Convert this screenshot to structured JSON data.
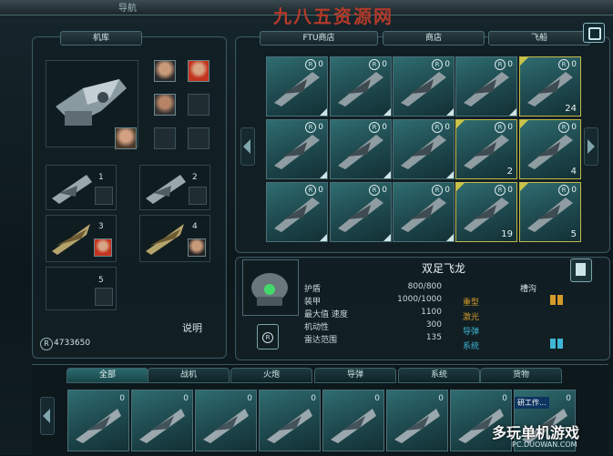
{
  "topbar": {
    "left_button": "导航",
    "watermark": "九八五资源网"
  },
  "left_panel": {
    "tab": "机库",
    "slots": [
      {
        "num": "1"
      },
      {
        "num": "2"
      },
      {
        "num": "3"
      },
      {
        "num": "4"
      },
      {
        "num": "5"
      }
    ],
    "help_label": "说明",
    "credits": "4733650"
  },
  "shop": {
    "tabs": [
      "FTU商店",
      "商店",
      "飞船"
    ],
    "grid": [
      {
        "qty": "0",
        "gold": false
      },
      {
        "qty": "0",
        "gold": false
      },
      {
        "qty": "0",
        "gold": false
      },
      {
        "qty": "0",
        "gold": false
      },
      {
        "qty": "0",
        "gold": true,
        "count": "24"
      },
      {
        "qty": "0",
        "gold": false
      },
      {
        "qty": "0",
        "gold": false
      },
      {
        "qty": "0",
        "gold": false
      },
      {
        "qty": "0",
        "gold": true,
        "count": "2"
      },
      {
        "qty": "0",
        "gold": true,
        "count": "4"
      },
      {
        "qty": "0",
        "gold": false
      },
      {
        "qty": "0",
        "gold": false
      },
      {
        "qty": "0",
        "gold": false
      },
      {
        "qty": "0",
        "gold": true,
        "count": "19"
      },
      {
        "qty": "0",
        "gold": true,
        "count": "5"
      }
    ]
  },
  "detail": {
    "name": "双足飞龙",
    "stats": [
      {
        "label": "护盾",
        "value": "800/800"
      },
      {
        "label": "装甲",
        "value": "1000/1000"
      },
      {
        "label": "最大值 速度",
        "value": "1100"
      },
      {
        "label": "机动性",
        "value": "300"
      },
      {
        "label": "雷达范围",
        "value": "135"
      }
    ],
    "slot_header": "槽沟",
    "categories": [
      {
        "label": "重型",
        "color": "#d49a2b"
      },
      {
        "label": "激光",
        "color": "#d49a2b"
      },
      {
        "label": "导弹",
        "color": "#3fb6d6"
      },
      {
        "label": "系统",
        "color": "#3fb6d6"
      }
    ]
  },
  "bottom": {
    "tabs": [
      "全部",
      "战机",
      "火炮",
      "导弹",
      "系统",
      "货物"
    ],
    "active": 0,
    "cards": [
      {
        "qty": "0"
      },
      {
        "qty": "0"
      },
      {
        "qty": "0"
      },
      {
        "qty": "0"
      },
      {
        "qty": "0"
      },
      {
        "qty": "0"
      },
      {
        "qty": "0"
      },
      {
        "qty": "0"
      }
    ],
    "logo_main": "多玩单机游戏",
    "logo_sub": "PC.DUOWAN.COM",
    "badge": "研工作..."
  }
}
